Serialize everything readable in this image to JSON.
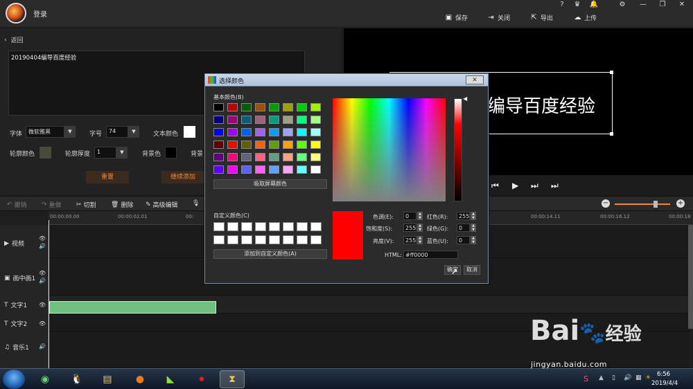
{
  "titlebar": {
    "login_label": "登录",
    "save_label": "保存",
    "close_label": "关闭",
    "export_label": "导出",
    "upload_label": "上传",
    "help_glyph": "?"
  },
  "editor": {
    "back_label": "返回",
    "text_value": "20190404编导百度经验",
    "font_label": "字体",
    "font_value": "微软雅黑",
    "size_label": "字号",
    "size_value": "74",
    "text_color_label": "文本颜色",
    "outline_color_label": "轮廓颜色",
    "outline_width_label": "轮廓厚度",
    "outline_width_value": "1",
    "bg_color_label": "背景色",
    "bg_label_2": "背景",
    "reset_label": "重置",
    "continue_add_label": "继续添加"
  },
  "preview": {
    "text": "编导百度经验"
  },
  "toolbar": {
    "undo_label": "撤销",
    "redo_label": "重做",
    "cut_label": "切割",
    "delete_label": "删除",
    "advanced_edit_label": "高级编辑"
  },
  "ruler": {
    "ticks": [
      "00:00:00.00",
      "00:00:02.01",
      "00:",
      "00:00:14.11",
      "00:00:16.12",
      "00:00:18"
    ]
  },
  "tracks": [
    {
      "label": "视频"
    },
    {
      "label": "画中画1"
    },
    {
      "label": "文字1"
    },
    {
      "label": "文字2"
    },
    {
      "label": "音乐1"
    }
  ],
  "dialog": {
    "title": "选择颜色",
    "basic_colors_label": "基本颜色(B)",
    "pick_screen_label": "吸取屏幕颜色",
    "custom_colors_label": "自定义颜色(C)",
    "add_custom_label": "添加到自定义颜色(A)",
    "hue_label": "色调(E):",
    "hue_value": "0",
    "sat_label": "饱和度(S):",
    "sat_value": "255",
    "lum_label": "亮度(V):",
    "lum_value": "255",
    "red_label": "红色(R):",
    "red_value": "255",
    "green_label": "绿色(G):",
    "green_value": "0",
    "blue_label": "蓝色(U):",
    "blue_value": "0",
    "html_label": "HTML:",
    "html_value": "#ff0000",
    "ok_label": "确定",
    "cancel_label": "取消",
    "close_glyph": "✕",
    "basic_colors": [
      "#000000",
      "#c00000",
      "#006000",
      "#a05000",
      "#00a000",
      "#a0a000",
      "#00d000",
      "#a0f000",
      "#000080",
      "#a00080",
      "#006080",
      "#a06080",
      "#00a080",
      "#a0a080",
      "#00ff80",
      "#a0ff80",
      "#0000ff",
      "#a000ff",
      "#0060ff",
      "#a060ff",
      "#00a0ff",
      "#a0a0ff",
      "#00ffff",
      "#a0ffff",
      "#600000",
      "#ff0000",
      "#606000",
      "#ff6000",
      "#60a000",
      "#ffa000",
      "#60ff00",
      "#ffff00",
      "#600080",
      "#ff0080",
      "#606080",
      "#ff6080",
      "#60a080",
      "#ffa080",
      "#60ff80",
      "#ffff80",
      "#6000ff",
      "#ff00ff",
      "#6060ff",
      "#ff60ff",
      "#60a0ff",
      "#ffa0ff",
      "#60ffff",
      "#ffffff"
    ],
    "selected_color": "#ff0000"
  },
  "taskbar": {
    "time": "6:56",
    "date": "2019/4/4"
  },
  "watermark": {
    "brand": "Bai",
    "brand_tail": "经验",
    "url": "jingyan.baidu.com"
  },
  "colors": {
    "accent": "#f08a3a",
    "clip": "#6fbf7f"
  }
}
